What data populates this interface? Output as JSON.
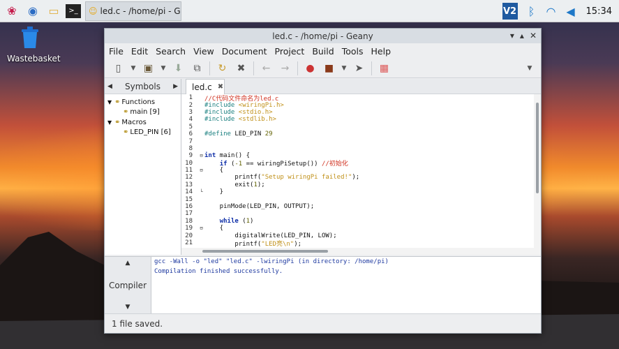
{
  "taskbar": {
    "task_title": "led.c - /home/pi - Ge...",
    "clock": "15:34",
    "vnc_label": "V2"
  },
  "desktop": {
    "wastebasket_label": "Wastebasket"
  },
  "window": {
    "title": "led.c - /home/pi - Geany",
    "menu": [
      "File",
      "Edit",
      "Search",
      "View",
      "Document",
      "Project",
      "Build",
      "Tools",
      "Help"
    ],
    "sidebar_tab": "Symbols",
    "tree": {
      "functions_label": "Functions",
      "main_label": "main [9]",
      "macros_label": "Macros",
      "ledpin_label": "LED_PIN [6]"
    },
    "editor_tab": "led.c",
    "code_lines": [
      {
        "n": "1",
        "fold": "",
        "html": "<span class='cm'>//C代码文件命名为led.c</span>"
      },
      {
        "n": "2",
        "fold": "",
        "html": "<span class='pp'>#include </span><span class='st'>&lt;wiringPi.h&gt;</span>"
      },
      {
        "n": "3",
        "fold": "",
        "html": "<span class='pp'>#include </span><span class='st'>&lt;stdio.h&gt;</span>"
      },
      {
        "n": "4",
        "fold": "",
        "html": "<span class='pp'>#include </span><span class='st'>&lt;stdlib.h&gt;</span>"
      },
      {
        "n": "5",
        "fold": "",
        "html": ""
      },
      {
        "n": "6",
        "fold": "",
        "html": "<span class='pp'>#define </span><span class='tx'>LED_PIN </span><span class='nm'>29</span>"
      },
      {
        "n": "7",
        "fold": "",
        "html": ""
      },
      {
        "n": "8",
        "fold": "",
        "html": ""
      },
      {
        "n": "9",
        "fold": "⊟",
        "html": "<span class='kw'>int</span><span class='tx'> main() {</span>"
      },
      {
        "n": "10",
        "fold": "",
        "html": "<span class='tx'>    </span><span class='kw'>if</span><span class='tx'> (</span><span class='nm'>-1</span><span class='tx'> == wiringPiSetup()) </span><span class='cm'>//初始化</span>"
      },
      {
        "n": "11",
        "fold": "⊟",
        "html": "<span class='tx'>    {</span>"
      },
      {
        "n": "12",
        "fold": "",
        "html": "<span class='tx'>        printf(</span><span class='st'>\"Setup wiringPi failed!\"</span><span class='tx'>);</span>"
      },
      {
        "n": "13",
        "fold": "",
        "html": "<span class='tx'>        exit(</span><span class='nm'>1</span><span class='tx'>);</span>"
      },
      {
        "n": "14",
        "fold": "└",
        "html": "<span class='tx'>    }</span>"
      },
      {
        "n": "15",
        "fold": "",
        "html": ""
      },
      {
        "n": "16",
        "fold": "",
        "html": "<span class='tx'>    pinMode(LED_PIN, OUTPUT);</span>"
      },
      {
        "n": "17",
        "fold": "",
        "html": ""
      },
      {
        "n": "18",
        "fold": "",
        "html": "<span class='tx'>    </span><span class='kw'>while</span><span class='tx'> (</span><span class='nm'>1</span><span class='tx'>)</span>"
      },
      {
        "n": "19",
        "fold": "⊟",
        "html": "<span class='tx'>    {</span>"
      },
      {
        "n": "20",
        "fold": "",
        "html": "<span class='tx'>        digitalWrite(LED_PIN, LOW);</span>"
      },
      {
        "n": "21",
        "fold": "",
        "html": "<span class='tx'>        printf(</span><span class='st'>\"LED亮\\n\"</span><span class='tx'>);</span>"
      }
    ],
    "compiler_tab": "Compiler",
    "compiler_lines": [
      "gcc -Wall -o \"led\" \"led.c\" -lwiringPi (in directory: /home/pi)",
      "Compilation finished successfully."
    ],
    "status": "1 file saved."
  }
}
